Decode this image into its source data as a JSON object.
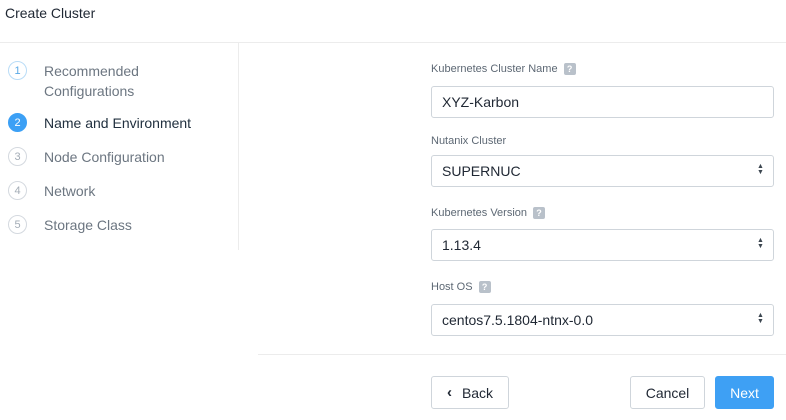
{
  "page": {
    "title": "Create Cluster"
  },
  "steps": [
    {
      "number": "1",
      "label": "Recommended Configurations",
      "state": "done"
    },
    {
      "number": "2",
      "label": "Name and Environment",
      "state": "active"
    },
    {
      "number": "3",
      "label": "Node Configuration",
      "state": "pending"
    },
    {
      "number": "4",
      "label": "Network",
      "state": "pending"
    },
    {
      "number": "5",
      "label": "Storage Class",
      "state": "pending"
    }
  ],
  "form": {
    "cluster_name": {
      "label": "Kubernetes Cluster Name",
      "help": "?",
      "value": "XYZ-Karbon"
    },
    "nutanix_cluster": {
      "label": "Nutanix Cluster",
      "value": "SUPERNUC"
    },
    "k8s_version": {
      "label": "Kubernetes Version",
      "help": "?",
      "value": "1.13.4"
    },
    "host_os": {
      "label": "Host OS",
      "help": "?",
      "value": "centos7.5.1804-ntnx-0.0"
    }
  },
  "footer": {
    "back_label": "Back",
    "cancel_label": "Cancel",
    "next_label": "Next"
  },
  "colors": {
    "accent": "#3ea0f4",
    "border": "#cfd5db"
  }
}
